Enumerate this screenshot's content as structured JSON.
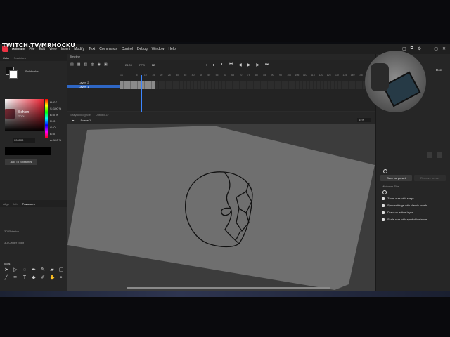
{
  "overlay": {
    "watermark": "TWITCH.TV/MRHOCKU"
  },
  "menubar": {
    "items": [
      "Animate",
      "File",
      "Edit",
      "View",
      "Insert",
      "Modify",
      "Text",
      "Commands",
      "Control",
      "Debug",
      "Window",
      "Help"
    ],
    "controls": [
      "▢",
      "⧉",
      "⚙",
      "—",
      "▢",
      "✕"
    ]
  },
  "left_panel": {
    "tabs": [
      "Color",
      "Swatches"
    ],
    "fill_type": "Solid color",
    "brush_name": "Schlen",
    "brush_sub": "TOOL",
    "color_labels": [
      "H: 0 °",
      "S: 100 %",
      "B: 0 %",
      "R: 0",
      "G: 0",
      "B: 0",
      "A: 100 %"
    ],
    "hex": "000000",
    "add_swatch": "Add To Swatches",
    "prop_tabs": [
      "Align",
      "Info",
      "Transform"
    ],
    "section_3d_rotation": "3D Rotation",
    "section_3d_center": "3D Center point",
    "tools_title": "Tools"
  },
  "timeline": {
    "title": "Timeline",
    "fps": "24.00",
    "fps_unit": "FPS",
    "frame": "12",
    "layers": [
      {
        "name": "Layer_2",
        "selected": false
      },
      {
        "name": "Layer_1",
        "selected": true
      }
    ],
    "ruler": [
      "1s",
      "",
      "5",
      "10",
      "15",
      "20",
      "25",
      "30",
      "35",
      "40",
      "45",
      "50",
      "55",
      "60",
      "65",
      "70",
      "75",
      "80",
      "85",
      "90",
      "95",
      "100",
      "105",
      "110",
      "115",
      "120",
      "125",
      "130",
      "135",
      "140",
      "145",
      "150"
    ]
  },
  "stage": {
    "breadcrumbs": [
      "StrayBulldog Ste!",
      "Untitled-1*"
    ],
    "scene": "Scene 1",
    "zoom": "64%"
  },
  "right_panel": {
    "doc_tab": "Doc",
    "save_preset": "Save as preset",
    "remove_preset": "Remove preset",
    "min_size": "Minimum Size",
    "checkboxes": [
      "Zoom size with stage",
      "Sync settings with classic brush",
      "Draw on active layer",
      "Scale size with symbol instance"
    ]
  },
  "colors": {
    "accent": "#2e66c4",
    "stage_bg": "#3c3c3c",
    "canvas": "#6f6f6f",
    "playhead": "#3c86ff"
  }
}
